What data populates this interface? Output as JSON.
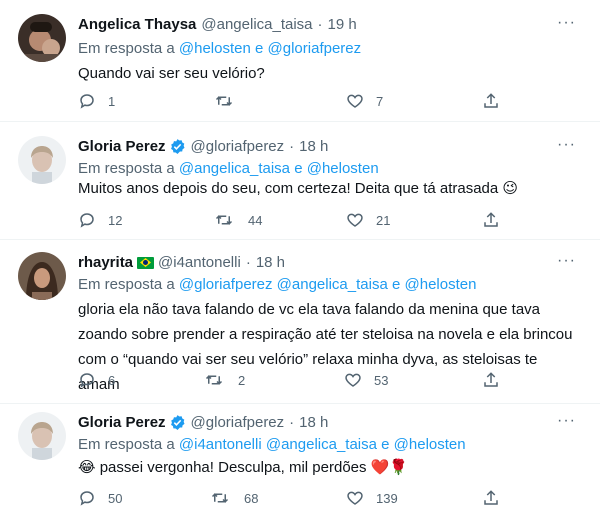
{
  "tweets": [
    {
      "name": "Angelica Thaysa",
      "handle": "@angelica_taisa",
      "dot": "·",
      "time": "19 h",
      "reply_prefix": "Em resposta a",
      "reply_to": [
        "@helosten",
        "@gloriafperez"
      ],
      "reply_joiner": "e",
      "text": "Quando vai ser seu velório?",
      "replies": "1",
      "retweets": "",
      "likes": "7"
    },
    {
      "name": "Gloria Perez",
      "handle": "@gloriafperez",
      "dot": "·",
      "time": "18 h",
      "reply_prefix": "Em resposta a",
      "reply_to": [
        "@angelica_taisa",
        "@helosten"
      ],
      "reply_joiner": "e",
      "text": "Muitos anos depois do seu, com certeza! Deita que tá atrasada 😉",
      "replies": "12",
      "retweets": "44",
      "likes": "21"
    },
    {
      "name": "rhayrita",
      "handle": "@i4antonelli",
      "dot": "·",
      "time": "18 h",
      "reply_prefix": "Em resposta a",
      "reply_to": [
        "@gloriafperez",
        "@angelica_taisa",
        "@helosten"
      ],
      "reply_joiner": "e",
      "text": "gloria ela não tava falando de vc ela tava falando da menina que tava zoando sobre prender a respiração até ter steloisa na novela e ela brincou com o “quando vai ser seu velório” relaxa minha dyva, as steloisas te amam",
      "replies": "6",
      "retweets": "2",
      "likes": "53"
    },
    {
      "name": "Gloria Perez",
      "handle": "@gloriafperez",
      "dot": "·",
      "time": "18 h",
      "reply_prefix": "Em resposta a",
      "reply_to": [
        "@i4antonelli",
        "@angelica_taisa",
        "@helosten"
      ],
      "reply_joiner": "e",
      "text": "😂 passei vergonha! Desculpa, mil perdões ❤️🌹",
      "replies": "50",
      "retweets": "68",
      "likes": "139"
    }
  ],
  "icons": {
    "more": "more-icon",
    "reply": "reply-icon",
    "retweet": "retweet-icon",
    "like": "heart-icon",
    "share": "share-icon",
    "verified": "verified-badge-icon",
    "flag": "brazil-flag-icon"
  },
  "colors": {
    "accent": "#1d9bf0",
    "secondary_text": "#536471",
    "primary_text": "#0f1419"
  }
}
